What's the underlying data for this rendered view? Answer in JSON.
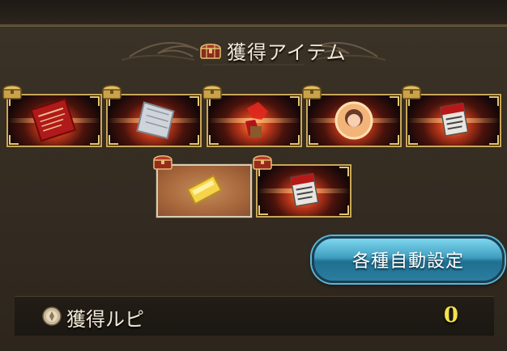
{
  "header": {
    "title": "獲得アイテム",
    "icon": "treasure-chest-icon"
  },
  "items": [
    {
      "name": "red-scroll",
      "badge": "gold-chest"
    },
    {
      "name": "silver-scale",
      "badge": "gold-chest"
    },
    {
      "name": "red-crystal-shard",
      "badge": "gold-chest"
    },
    {
      "name": "summon-character-orb",
      "badge": "gold-chest"
    },
    {
      "name": "red-ticket",
      "badge": "gold-chest"
    },
    {
      "name": "gold-bar",
      "badge": "red-chest"
    },
    {
      "name": "red-ticket",
      "badge": "red-chest"
    }
  ],
  "auto_settings_button": {
    "label": "各種自動設定"
  },
  "rupi": {
    "label": "獲得ルピ",
    "value": "0"
  },
  "colors": {
    "title_text": "#f3ead7",
    "rupi_value": "#f4e24a",
    "button": "#3f9fc0",
    "frame_gold": "#c9a75a"
  }
}
